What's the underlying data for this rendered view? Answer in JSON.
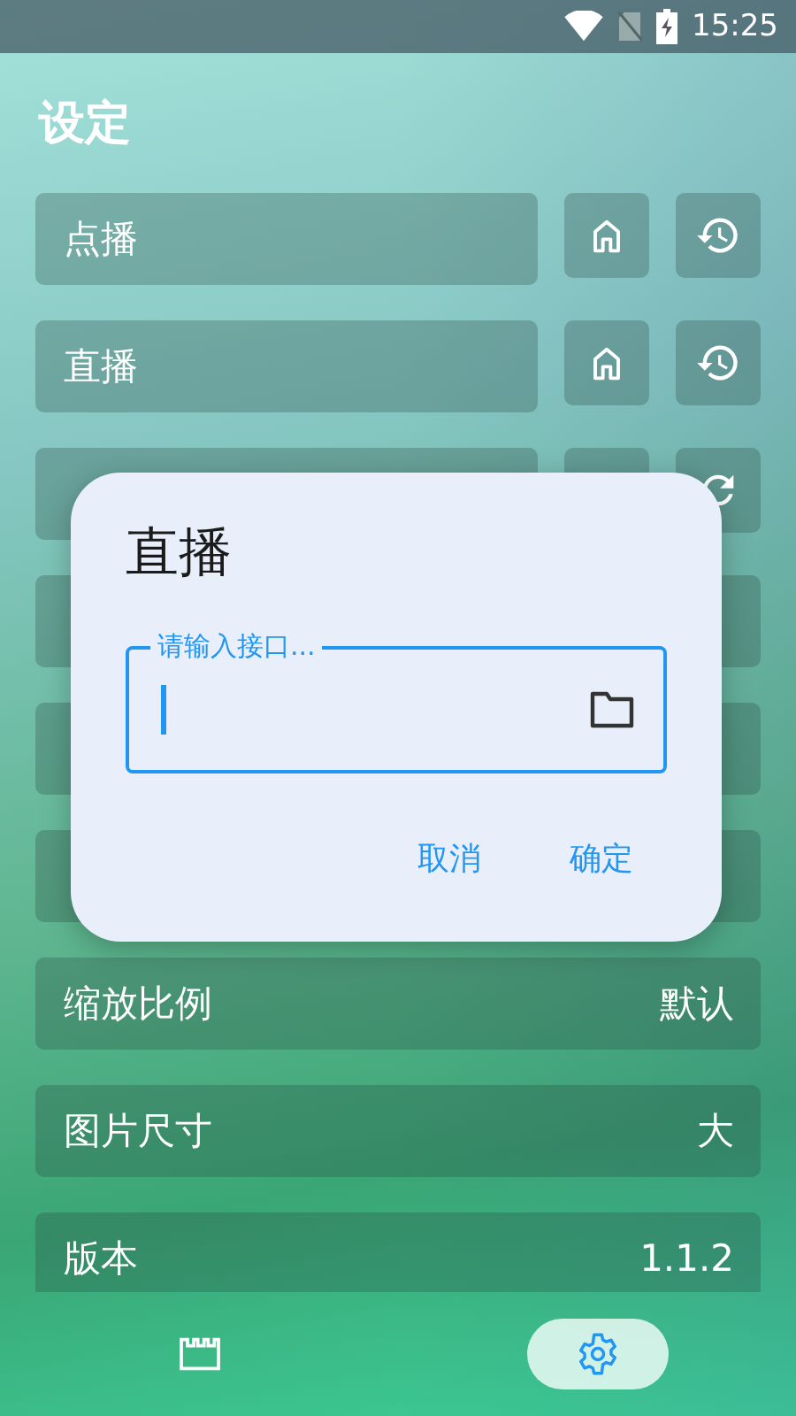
{
  "status_bar": {
    "time": "15:25"
  },
  "title": "设定",
  "rows": [
    {
      "label": "点播",
      "actions": [
        {
          "kind": "home"
        },
        {
          "kind": "history"
        }
      ]
    },
    {
      "label": "直播",
      "actions": [
        {
          "kind": "home"
        },
        {
          "kind": "history"
        }
      ]
    },
    {
      "actions": [
        {
          "kind": "blank"
        },
        {
          "kind": "refresh"
        }
      ]
    },
    {},
    {},
    {},
    {
      "label": "缩放比例",
      "value": "默认"
    },
    {
      "label": "图片尺寸",
      "value": "大"
    },
    {
      "label": "版本",
      "value": "1.1.2"
    }
  ],
  "dialog": {
    "title": "直播",
    "field": {
      "placeholder": "请输入接口..."
    },
    "buttons": [
      "取消",
      "确定"
    ]
  },
  "bottom_nav": [
    {
      "kind": "film",
      "selected": false
    },
    {
      "kind": "gear",
      "selected": true
    }
  ]
}
